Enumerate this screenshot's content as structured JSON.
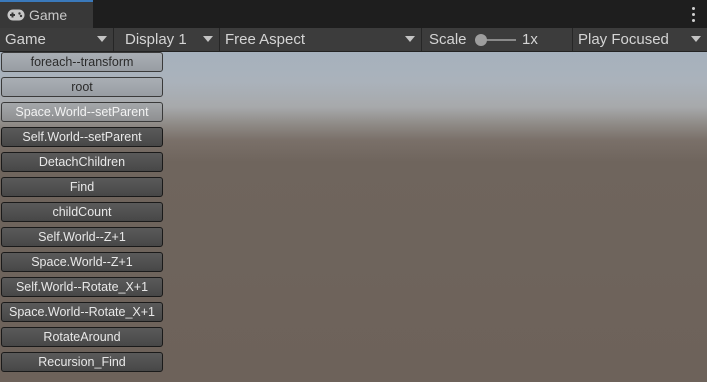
{
  "tab": {
    "title": "Game",
    "icon": "gamepad-icon",
    "accent_color": "#3a79bb"
  },
  "toolbar": {
    "view_select": "Game",
    "display_select": "Display 1",
    "aspect_select": "Free Aspect",
    "scale_label": "Scale",
    "scale_value": "1x",
    "play_mode_select": "Play Focused"
  },
  "buttons": [
    {
      "label": "foreach--transform"
    },
    {
      "label": "root"
    },
    {
      "label": "Space.World--setParent"
    },
    {
      "label": "Self.World--setParent"
    },
    {
      "label": "DetachChildren"
    },
    {
      "label": "Find"
    },
    {
      "label": "childCount"
    },
    {
      "label": "Self.World--Z+1"
    },
    {
      "label": "Space.World--Z+1"
    },
    {
      "label": "Self.World--Rotate_X+1"
    },
    {
      "label": "Space.World--Rotate_X+1"
    },
    {
      "label": "RotateAround"
    },
    {
      "label": "Recursion_Find"
    }
  ]
}
